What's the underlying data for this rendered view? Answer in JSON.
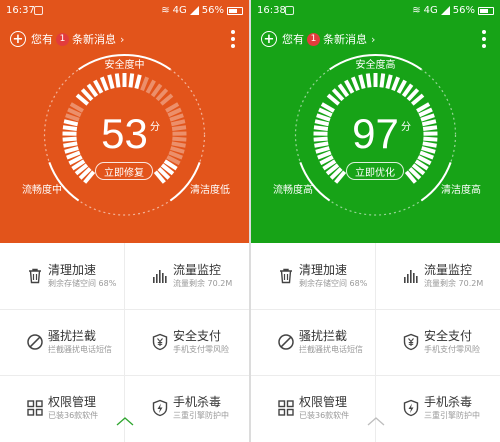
{
  "phones": [
    {
      "theme_color": "#e2541b",
      "status_time": "16:37",
      "status_signal": "4G",
      "status_battery": "56%",
      "notice_prefix": "您有",
      "notice_count": "1",
      "notice_suffix": "条新消息",
      "gauge_top_label": "安全度中",
      "gauge_left_label": "流畅度中",
      "gauge_right_label": "清洁度低",
      "score": "53",
      "score_unit": "分",
      "action_label": "立即修复",
      "left_level": 0.8,
      "top_level": 0.62,
      "right_level": 0.25,
      "caret_color": "#2ea52e",
      "tiles": [
        {
          "icon": "trash-icon",
          "title": "清理加速",
          "subtitle": "剩余存储空间 68%"
        },
        {
          "icon": "bars-icon",
          "title": "流量监控",
          "subtitle": "流量剩余 70.2M"
        },
        {
          "icon": "block-icon",
          "title": "骚扰拦截",
          "subtitle": "拦截骚扰电话短信"
        },
        {
          "icon": "shield-yen-icon",
          "title": "安全支付",
          "subtitle": "手机支付零风险"
        },
        {
          "icon": "grid-icon",
          "title": "权限管理",
          "subtitle": "已装36款软件"
        },
        {
          "icon": "shield-bolt-icon",
          "title": "手机杀毒",
          "subtitle": "三重引擎防护中"
        }
      ]
    },
    {
      "theme_color": "#17a317",
      "status_time": "16:38",
      "status_signal": "4G",
      "status_battery": "56%",
      "notice_prefix": "您有",
      "notice_count": "1",
      "notice_suffix": "条新消息",
      "gauge_top_label": "安全度高",
      "gauge_left_label": "流畅度高",
      "gauge_right_label": "清洁度高",
      "score": "97",
      "score_unit": "分",
      "action_label": "立即优化",
      "left_level": 1.0,
      "top_level": 0.95,
      "right_level": 0.95,
      "caret_color": "#bdbdbd",
      "tiles": [
        {
          "icon": "trash-icon",
          "title": "清理加速",
          "subtitle": "剩余存储空间 68%"
        },
        {
          "icon": "bars-icon",
          "title": "流量监控",
          "subtitle": "流量剩余 70.2M"
        },
        {
          "icon": "block-icon",
          "title": "骚扰拦截",
          "subtitle": "拦截骚扰电话短信"
        },
        {
          "icon": "shield-yen-icon",
          "title": "安全支付",
          "subtitle": "手机支付零风险"
        },
        {
          "icon": "grid-icon",
          "title": "权限管理",
          "subtitle": "已装36款软件"
        },
        {
          "icon": "shield-bolt-icon",
          "title": "手机杀毒",
          "subtitle": "三重引擎防护中"
        }
      ]
    }
  ]
}
